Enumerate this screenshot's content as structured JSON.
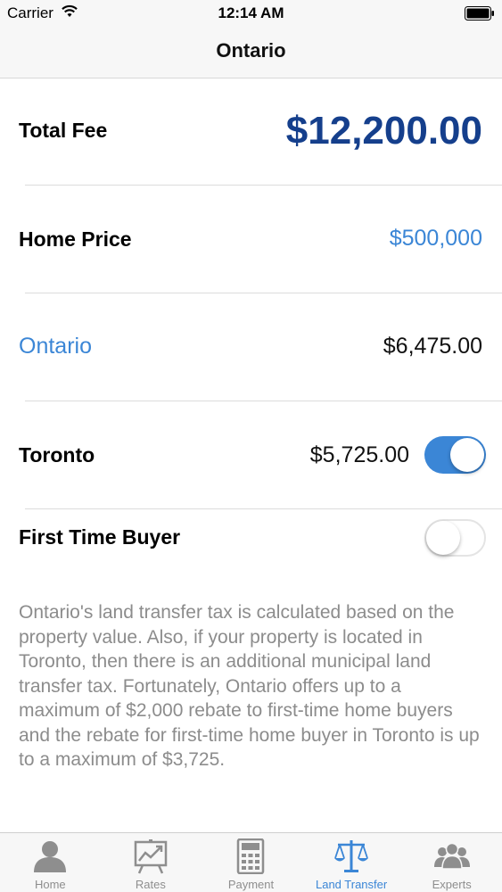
{
  "status_bar": {
    "carrier": "Carrier",
    "time": "12:14 AM"
  },
  "nav": {
    "title": "Ontario"
  },
  "summary": {
    "total_label": "Total Fee",
    "total_value": "$12,200.00",
    "price_label": "Home Price",
    "price_value": "$500,000",
    "province_label": "Ontario",
    "province_value": "$6,475.00",
    "city_label": "Toronto",
    "city_value": "$5,725.00",
    "city_toggle_on": true,
    "first_time_label": "First Time Buyer",
    "first_time_toggle_on": false
  },
  "description": "Ontario's land transfer tax is calculated based on the property value. Also, if your property is located in Toronto, then there is an additional municipal land transfer tax. Fortunately, Ontario offers up to a maximum of $2,000 rebate to first-time home buyers and the rebate for first-time home buyer in Toronto is up to a maximum of $3,725.",
  "tabs": [
    {
      "label": "Home",
      "icon": "person-icon",
      "active": false
    },
    {
      "label": "Rates",
      "icon": "chart-board-icon",
      "active": false
    },
    {
      "label": "Payment",
      "icon": "calculator-icon",
      "active": false
    },
    {
      "label": "Land Transfer",
      "icon": "scales-icon",
      "active": true
    },
    {
      "label": "Experts",
      "icon": "group-icon",
      "active": false
    }
  ],
  "colors": {
    "accent": "#3b86d6",
    "total": "#153f8c",
    "inactive_icon": "#8e8e8e"
  }
}
